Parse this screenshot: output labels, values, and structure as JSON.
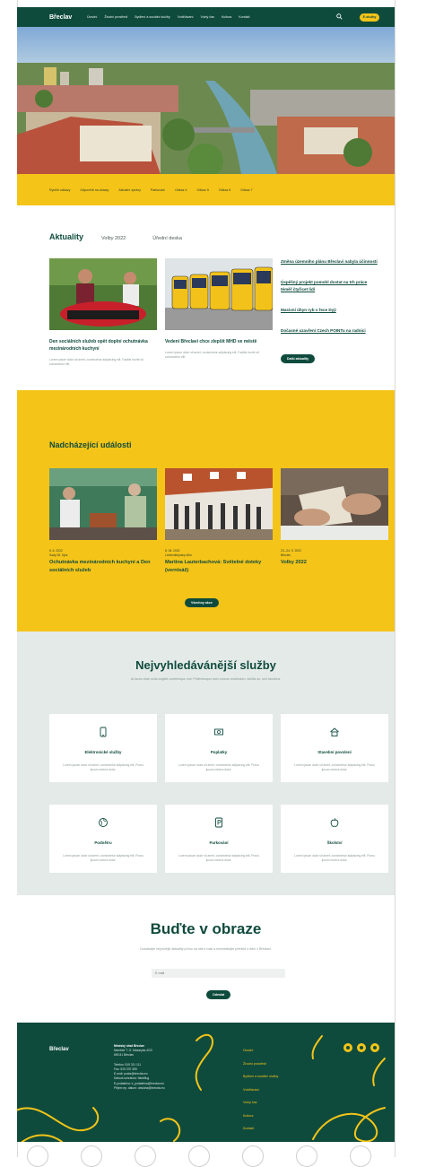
{
  "header": {
    "logo": "Břeclav",
    "nav": [
      "Úvodní",
      "Životní prostředí",
      "Bydlení a sociální služby",
      "Vzdělávání",
      "Volný čas",
      "Kultura",
      "Kontakt"
    ],
    "pill_label": "E-služby"
  },
  "quicknav": [
    "Rychlé odkazy",
    "Odpovědi na dotazy",
    "Aktuální zprávy",
    "Parkování",
    "Odkaz 4",
    "Odkaz 5",
    "Odkaz 6",
    "Odkaz 7"
  ],
  "news": {
    "tabs": [
      "Aktuality",
      "Volby 2022",
      "Úřední deska"
    ],
    "cards": [
      {
        "title": "Den sociálních služeb opět doplní ochutnávka mezinárodních kuchyní",
        "excerpt": "Lorem ipsum dolor sit amet, consectetur adipiscing elit. Facilisi morbi sit consectetur elit."
      },
      {
        "title": "Vedení Břeclavi chce zlepšit MHD ve městě",
        "excerpt": "Lorem ipsum dolor sit amet, consectetur adipiscing elit. Facilisi morbi sit consectetur elit."
      }
    ],
    "side_links": [
      "Změna územního plánu Břeclavi nabyla účinnosti",
      "Úspěšný projekt pomohl dostat na trh práce téměř čtyřicet lidí",
      "Masivní úhyn ryb v řece Dyji",
      "Dočasné uzavření Czech POINTu na radnici"
    ],
    "more_label": "Další aktuality"
  },
  "events": {
    "title": "Nadcházející události",
    "items": [
      {
        "meta1": "6. 6. 2022",
        "meta2": "Sady 28. října",
        "title": "Ochutnávka mezinárodních kuchyní a Den sociálních služeb"
      },
      {
        "meta1": "8. 06. 2022",
        "meta2": "Lichtenštejnský dům",
        "title": "Martina Lauterbachová: Světelné doteky (vernisáž)"
      },
      {
        "meta1": "23.–24. 9. 2022",
        "meta2": "Břeclav",
        "title": "Volby 2022"
      }
    ],
    "more_label": "Všechny akce"
  },
  "services": {
    "title": "Nejvyhledávánější služby",
    "subtitle": "At lacus vitae nulla sagittis scelerisque nisl. Pellentesque duis cursus vestibulum, facilisi ac, sed faucibus.",
    "items": [
      {
        "name": "Elektronické služby",
        "icon": "phone-icon",
        "desc": "Lorem ipsum dolor sit amet, consectetur adipiscing elit. Purus ipsum viverra dolor."
      },
      {
        "name": "Poplatky",
        "icon": "money-icon",
        "desc": "Lorem ipsum dolor sit amet, consectetur adipiscing elit. Purus ipsum viverra dolor."
      },
      {
        "name": "Stavební povolení",
        "icon": "house-icon",
        "desc": "Lorem ipsum dolor sit amet, consectetur adipiscing elit. Purus ipsum viverra dolor."
      },
      {
        "name": "Podnětru",
        "icon": "globe-icon",
        "desc": "Lorem ipsum dolor sit amet, consectetur adipiscing elit. Purus ipsum viverra dolor."
      },
      {
        "name": "Parkování",
        "icon": "parking-icon",
        "desc": "Lorem ipsum dolor sit amet, consectetur adipiscing elit. Purus ipsum viverra dolor."
      },
      {
        "name": "Školství",
        "icon": "apple-icon",
        "desc": "Lorem ipsum dolor sit amet, consectetur adipiscing elit. Purus ipsum viverra dolor."
      }
    ]
  },
  "newsletter": {
    "title": "Buďte v obraze",
    "subtitle": "Dostávejte nejnovější aktuality přímo na váš e-mail a nezmeškejte přehled o dění v Břeclavi.",
    "placeholder": "E-mail",
    "button": "Odeslat"
  },
  "footer": {
    "logo": "Břeclav",
    "address": [
      "Městský úřad Břeclav",
      "Náměstí T. G. Masaryka 42/3",
      "690 81 Břeclav",
      "",
      "Telefon: 519 311 111",
      "Fax: 519 370 359",
      "E-mail: posta@breclav.eu",
      "Datová schránka: 9akb5ug",
      "E-podatelna: e_podatelna@breclav.eu",
      "Přijem ep. datum: obsluha@breclav.eu"
    ],
    "links": [
      "Úvodní",
      "Životní prostředí",
      "Bydlení a sociální služby",
      "Vzdělávání",
      "Volný čas",
      "Kultura",
      "Kontakt"
    ],
    "social": [
      "facebook-icon",
      "instagram-icon",
      "youtube-icon"
    ]
  },
  "colors": {
    "brand_green": "#0f4b3d",
    "brand_yellow": "#f4c418",
    "services_bg": "#e4eae8"
  }
}
